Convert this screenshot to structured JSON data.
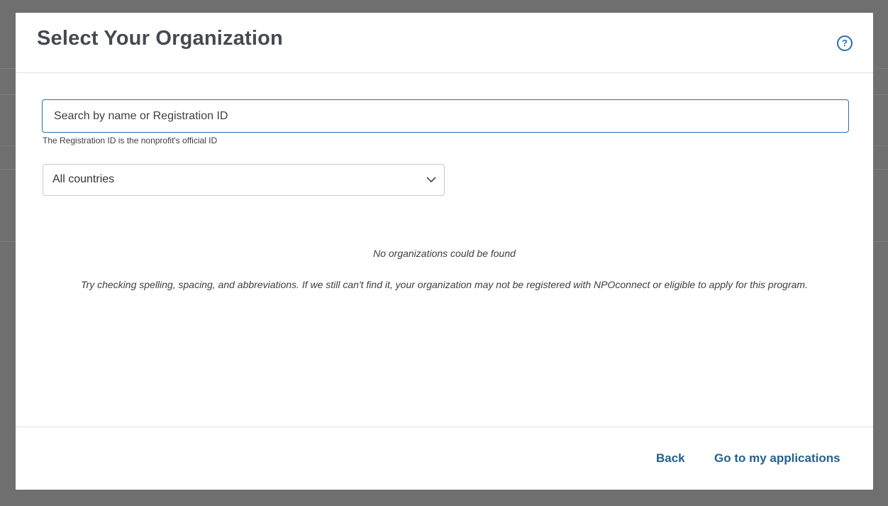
{
  "modal": {
    "title": "Select Your Organization",
    "help_label": "?"
  },
  "search": {
    "placeholder": "Search by name or Registration ID",
    "value": "",
    "helper": "The Registration ID is the nonprofit's official ID"
  },
  "country_filter": {
    "selected": "All countries"
  },
  "empty_state": {
    "title": "No organizations could be found",
    "description": "Try checking spelling, spacing, and abbreviations. If we still can't find it, your organization may not be registered with NPOconnect or eligible to apply for this program."
  },
  "footer": {
    "back_label": "Back",
    "applications_label": "Go to my applications"
  },
  "colors": {
    "accent": "#2a6fae",
    "link": "#23618e",
    "overlay": "#6f6f6f"
  }
}
